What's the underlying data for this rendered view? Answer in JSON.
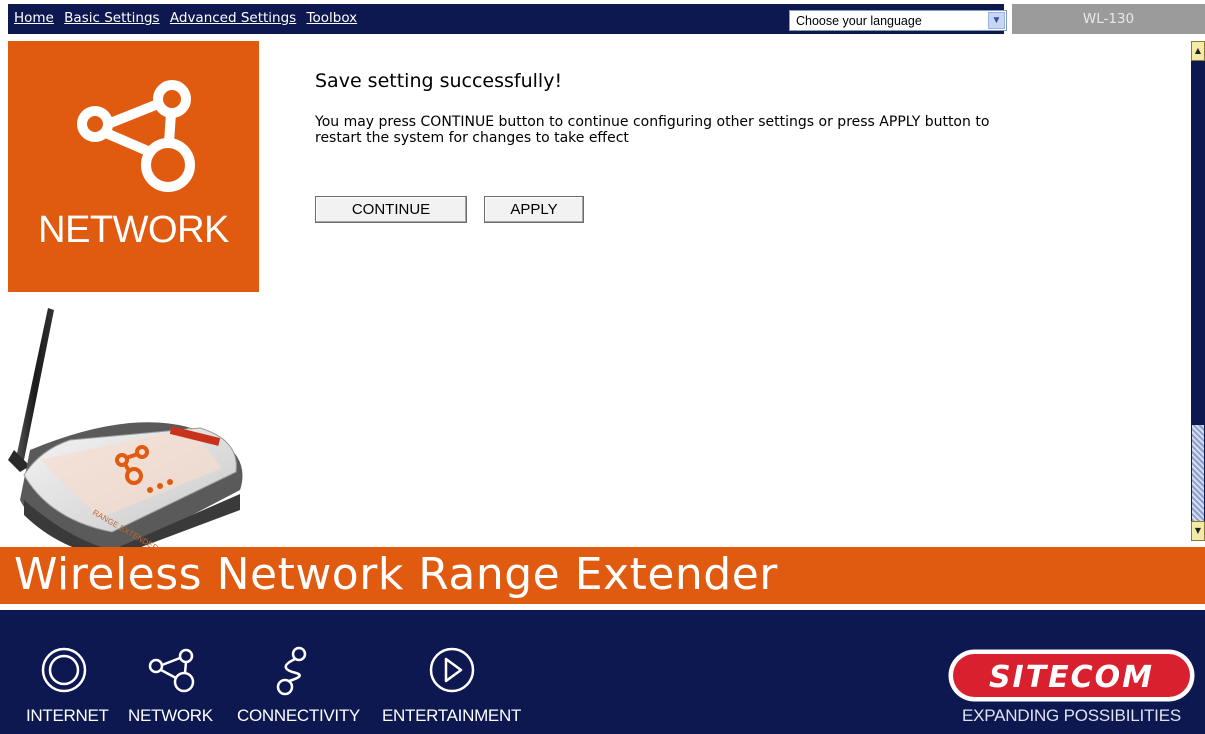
{
  "nav": {
    "links": [
      "Home",
      "Basic Settings",
      "Advanced Settings",
      "Toolbox"
    ],
    "language_select": "Choose your language",
    "model": "WL-130"
  },
  "sidebar": {
    "tile_label": "NETWORK"
  },
  "main": {
    "title": "Save setting successfully!",
    "message": "You may press CONTINUE button to continue configuring other settings or press APPLY button to restart the system for changes to take effect",
    "continue_label": "CONTINUE",
    "apply_label": "APPLY"
  },
  "banner": {
    "text": "Wireless Network Range Extender"
  },
  "footer": {
    "items": [
      "INTERNET",
      "NETWORK",
      "CONNECTIVITY",
      "ENTERTAINMENT"
    ],
    "logo_text": "SITECOM",
    "tagline": "EXPANDING POSSIBILITIES"
  },
  "device_label": "RANGE EXTENDER",
  "colors": {
    "navy": "#0d1750",
    "orange": "#e05b10",
    "sitecom_red": "#d9202e"
  }
}
